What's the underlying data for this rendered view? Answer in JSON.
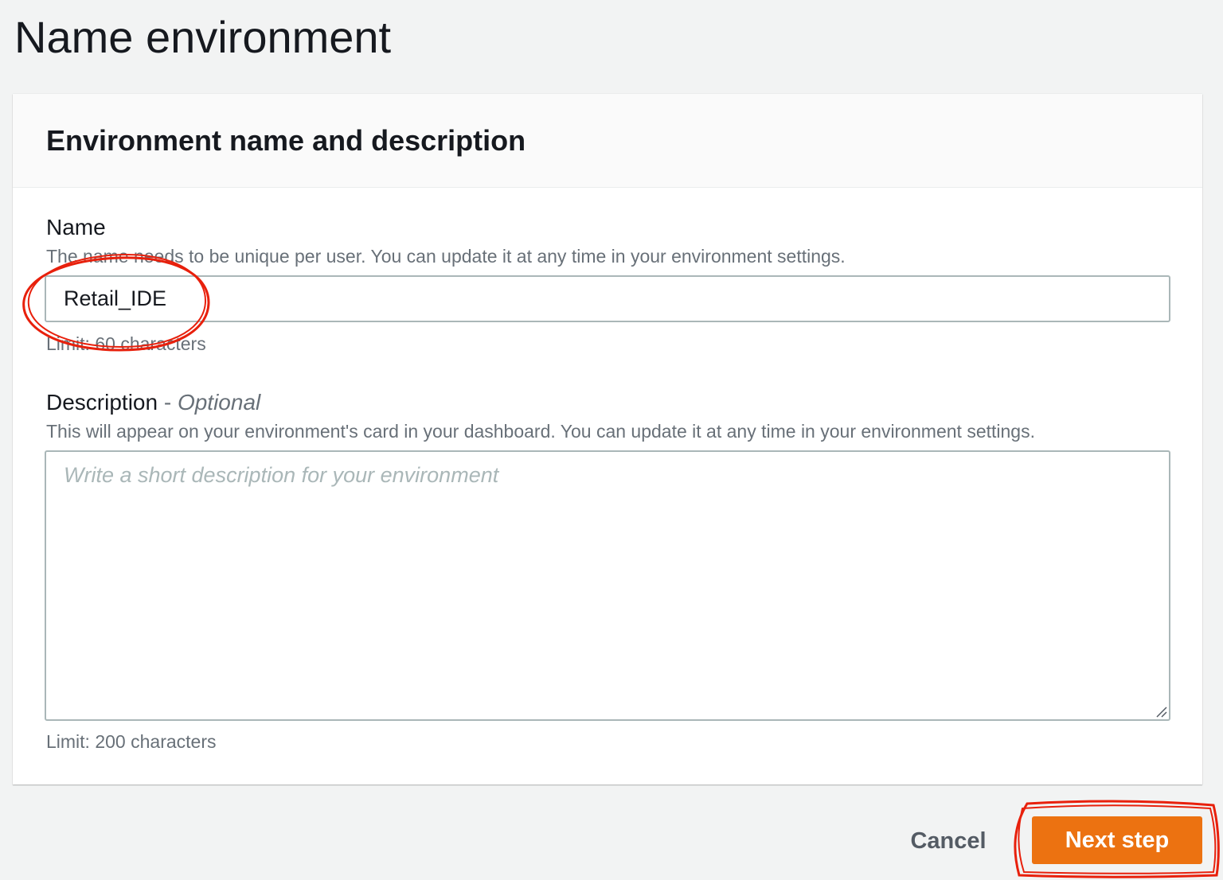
{
  "page": {
    "title": "Name environment"
  },
  "card": {
    "title": "Environment name and description"
  },
  "name_field": {
    "label": "Name",
    "description": "The name needs to be unique per user. You can update it at any time in your environment settings.",
    "value": "Retail_IDE",
    "limit": "Limit: 60 characters"
  },
  "description_field": {
    "label": "Description",
    "dash": " - ",
    "optional": "Optional",
    "description": "This will appear on your environment's card in your dashboard. You can update it at any time in your environment settings.",
    "placeholder": "Write a short description for your environment",
    "limit": "Limit: 200 characters"
  },
  "actions": {
    "cancel_label": "Cancel",
    "next_label": "Next step"
  },
  "colors": {
    "primary_button": "#ec7211",
    "annotation": "#e8200c"
  }
}
